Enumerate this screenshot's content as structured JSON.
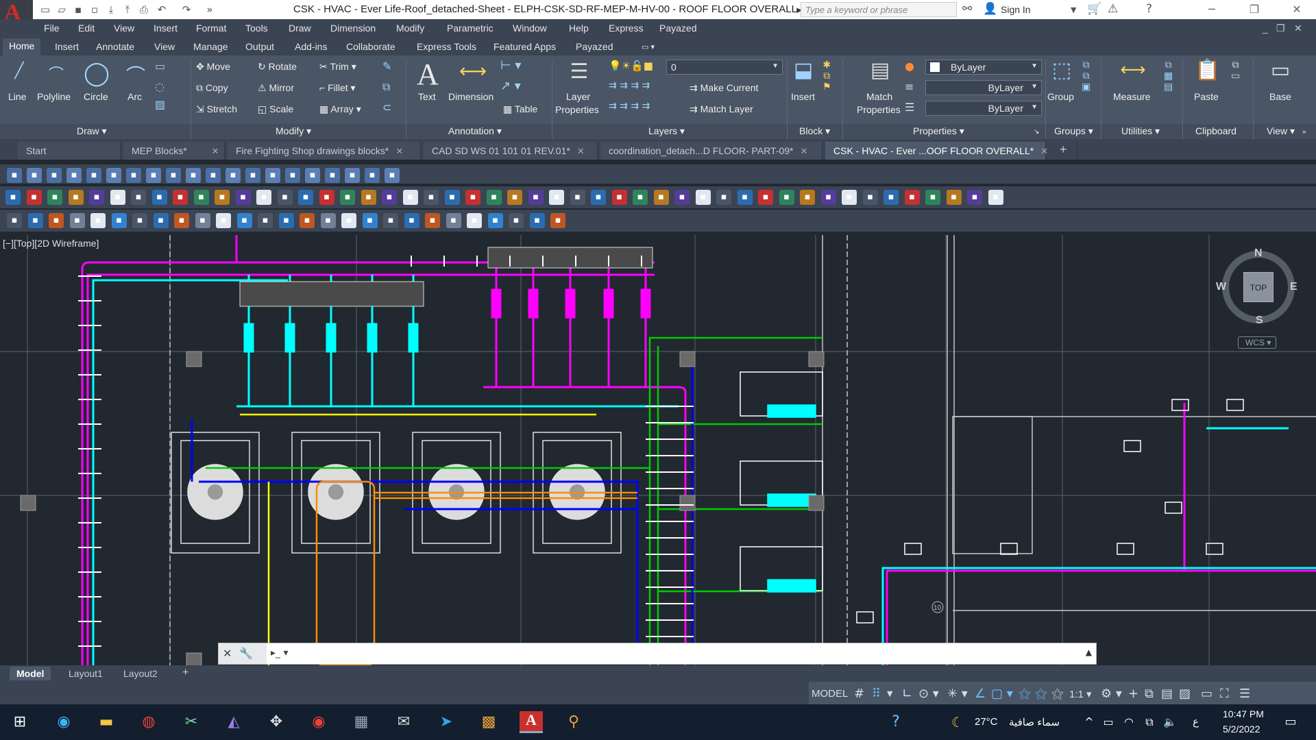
{
  "titlebar": {
    "app_logo": "A",
    "title": "CSK - HVAC - Ever Life-Roof_detached-Sheet - ELPH-CSK-SD-RF-MEP-M-HV-00 - ROOF FLOOR OVERALL.dwg",
    "search_placeholder": "Type a keyword or phrase",
    "sign_in": "Sign In"
  },
  "menu": [
    "File",
    "Edit",
    "View",
    "Insert",
    "Format",
    "Tools",
    "Draw",
    "Dimension",
    "Modify",
    "Parametric",
    "Window",
    "Help",
    "Express",
    "Payazed"
  ],
  "ribbon_tabs": [
    "Home",
    "Insert",
    "Annotate",
    "View",
    "Manage",
    "Output",
    "Add-ins",
    "Collaborate",
    "Express Tools",
    "Featured Apps",
    "Payazed"
  ],
  "ribbon": {
    "draw": {
      "title": "Draw",
      "line": "Line",
      "polyline": "Polyline",
      "circle": "Circle",
      "arc": "Arc"
    },
    "modify": {
      "title": "Modify",
      "move": "Move",
      "rotate": "Rotate",
      "trim": "Trim",
      "copy": "Copy",
      "mirror": "Mirror",
      "fillet": "Fillet",
      "stretch": "Stretch",
      "scale": "Scale",
      "array": "Array"
    },
    "annotation": {
      "title": "Annotation",
      "text": "Text",
      "dimension": "Dimension",
      "table": "Table"
    },
    "layers": {
      "title": "Layers",
      "layer_properties_1": "Layer",
      "layer_properties_2": "Properties",
      "current_layer": "0",
      "make_current": "Make Current",
      "match_layer": "Match Layer"
    },
    "block": {
      "title": "Block",
      "insert": "Insert"
    },
    "properties": {
      "title": "Properties",
      "match_1": "Match",
      "match_2": "Properties",
      "color": "ByLayer",
      "linetype": "ByLayer",
      "lineweight": "ByLayer"
    },
    "groups": {
      "title": "Groups",
      "group": "Group"
    },
    "utilities": {
      "title": "Utilities",
      "measure": "Measure"
    },
    "clipboard": {
      "title": "Clipboard",
      "paste": "Paste"
    },
    "view": {
      "title": "View",
      "base": "Base"
    }
  },
  "doc_tabs": [
    {
      "label": "Start"
    },
    {
      "label": "MEP Blocks*"
    },
    {
      "label": "Fire Fighting Shop drawings blocks*"
    },
    {
      "label": "CAD SD WS 01 101 01 REV.01*"
    },
    {
      "label": "coordination_detach...D  FLOOR- PART-09*"
    },
    {
      "label": "CSK - HVAC - Ever ...OOF FLOOR OVERALL*"
    }
  ],
  "viewport": {
    "label": "[−][Top][2D Wireframe]"
  },
  "viewcube": {
    "n": "N",
    "s": "S",
    "e": "E",
    "w": "W",
    "top": "TOP",
    "wcs": "WCS"
  },
  "drawing": {
    "marker": "10"
  },
  "layout_tabs": [
    "Model",
    "Layout1",
    "Layout2"
  ],
  "status": {
    "model": "MODEL",
    "scale": "1:1"
  },
  "taskbar": {
    "weather_temp": "27°C",
    "weather_text": "سماء صافية",
    "lang": "ع",
    "time": "10:47 PM",
    "date": "5/2/2022"
  },
  "colors": {
    "accent_red": "#d42a2a",
    "ribbon_bg": "#4a5565",
    "canvas_bg": "#212830",
    "pipe_magenta": "#ff00ff",
    "pipe_cyan": "#00ffff",
    "pipe_green": "#00cc00",
    "pipe_blue": "#0000ff",
    "pipe_yellow": "#ffff00",
    "pipe_orange": "#ff8c00"
  }
}
